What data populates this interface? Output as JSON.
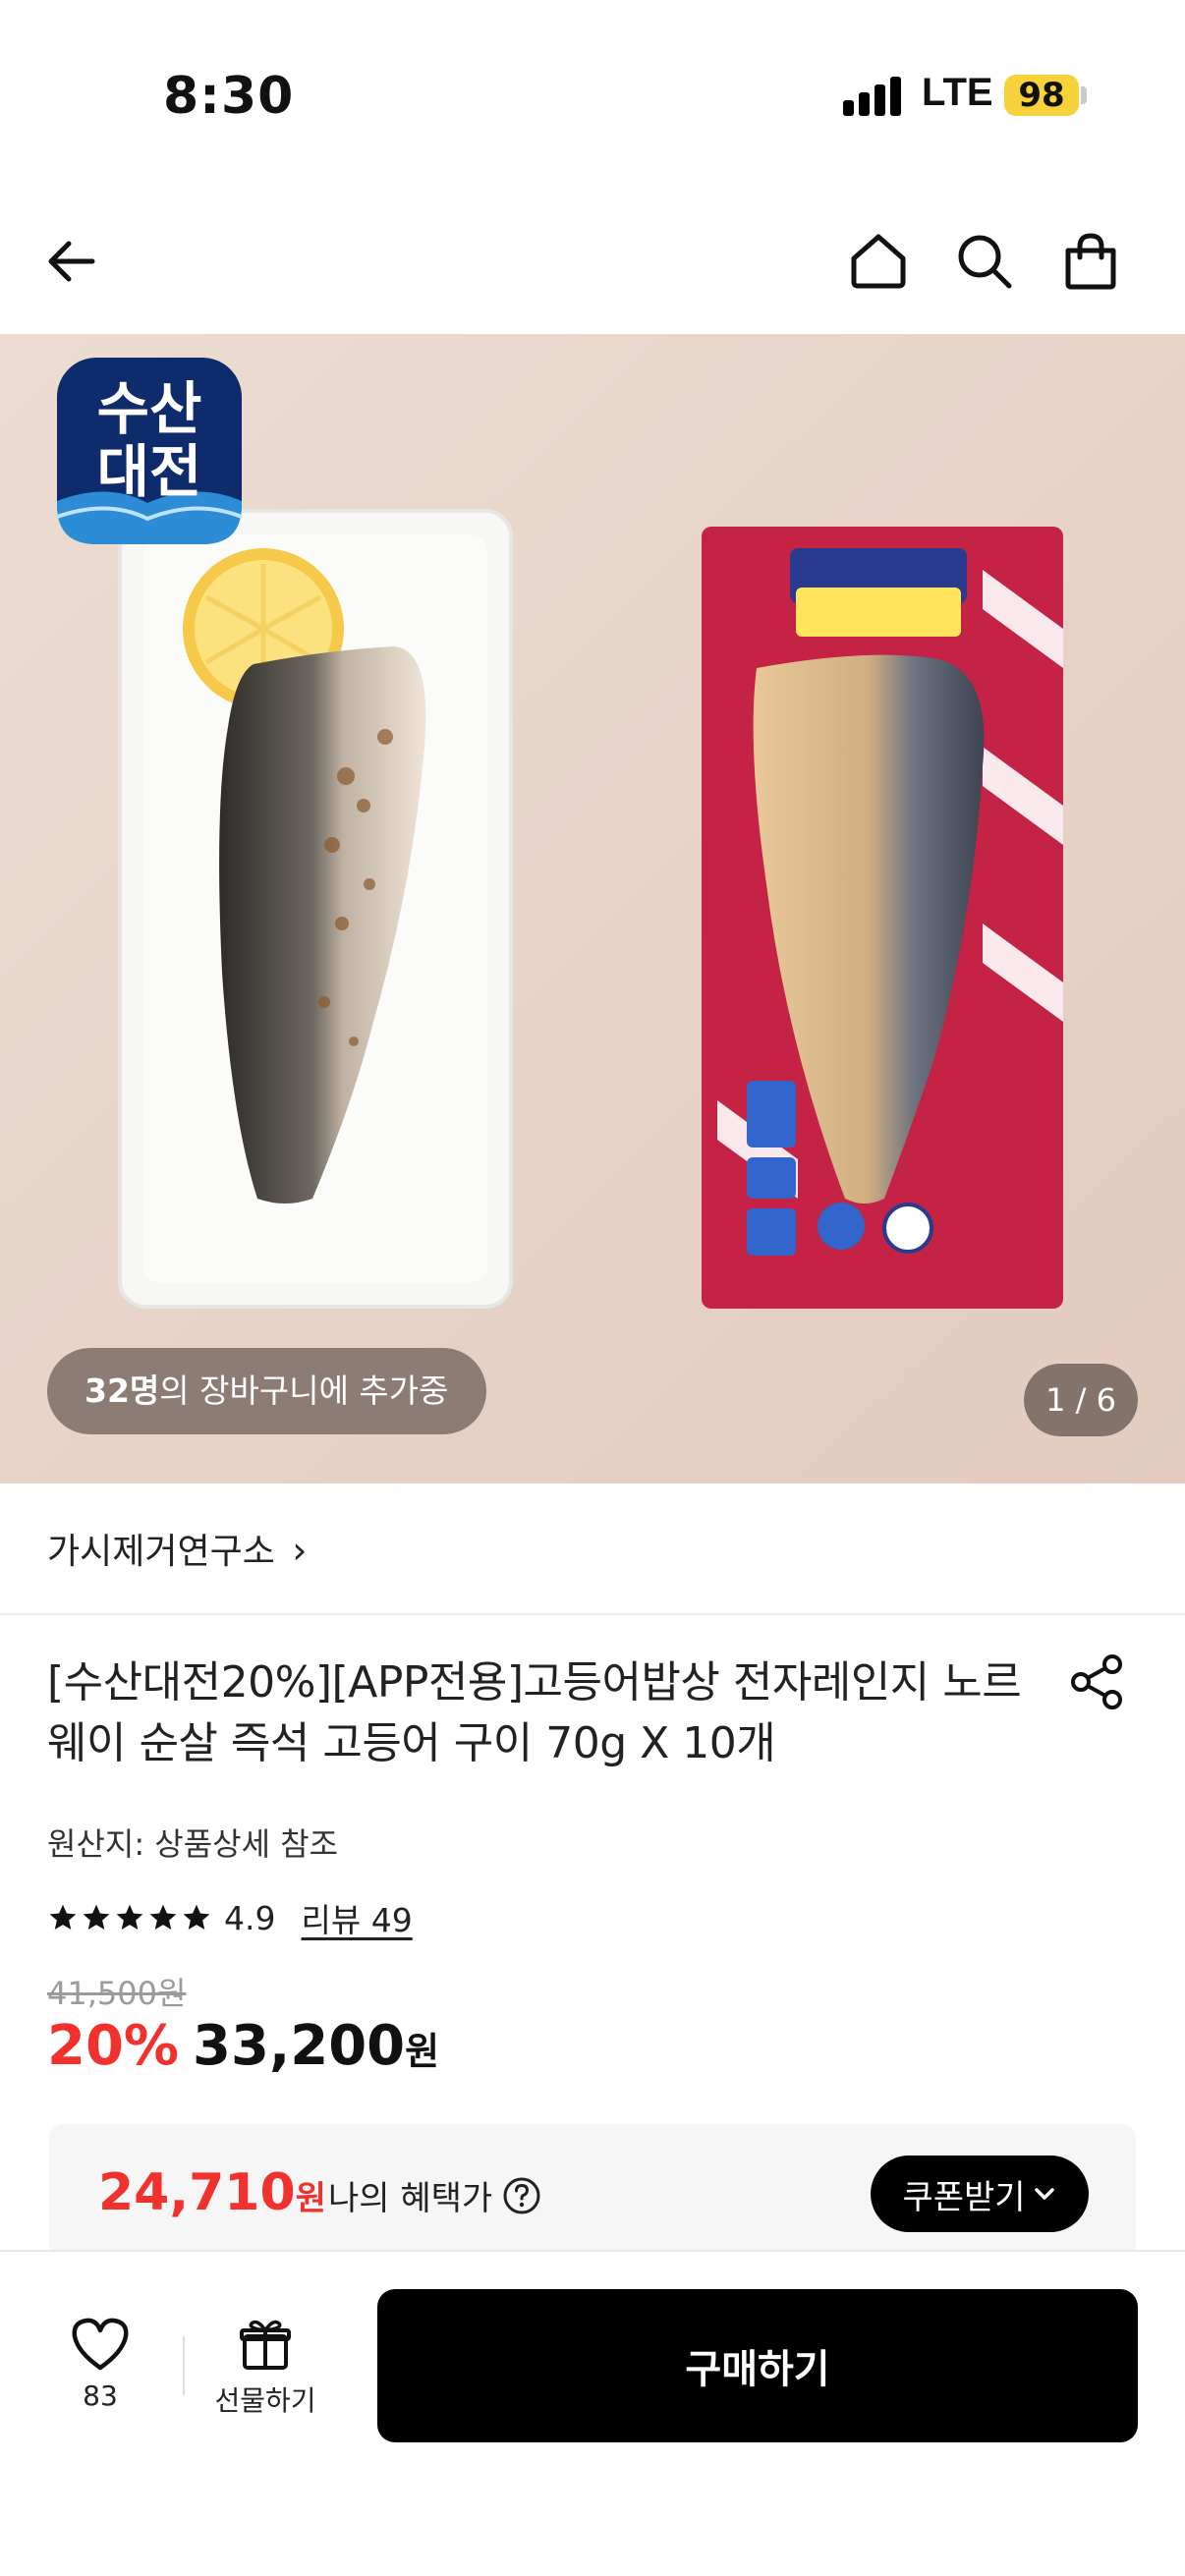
{
  "status_bar": {
    "time": "8:30",
    "network": "LTE",
    "battery": "98"
  },
  "hero": {
    "logo_text_line1": "수산",
    "logo_text_line2": "대전",
    "cart_count": "32명",
    "cart_text": "의 장바구니에 추가중",
    "page_indicator": "1 / 6"
  },
  "brand": {
    "name": "가시제거연구소",
    "chevron": "›"
  },
  "product": {
    "title": "[수산대전20%][APP전용]고등어밥상 전자레인지 노르웨이 순살 즉석 고등어 구이 70g X 10개",
    "origin": "원산지: 상품상세 참조",
    "rating": "4.9",
    "review_label": "리뷰 49",
    "original_price": "41,500원",
    "discount": "20%",
    "price": "33,200",
    "price_unit": "원"
  },
  "benefit": {
    "price": "24,710",
    "price_unit": "원",
    "label": "나의 혜택가",
    "coupon_button": "쿠폰받기"
  },
  "bottom_bar": {
    "like_count": "83",
    "gift_label": "선물하기",
    "buy_label": "구매하기"
  },
  "colors": {
    "accent_red": "#f0312d",
    "battery_yellow": "#f7d23b",
    "hero_background": "#e9d6cc"
  },
  "icons": {
    "back": "arrow-left-icon",
    "home": "home-icon",
    "search": "search-icon",
    "bag": "shopping-bag-icon",
    "share": "share-icon",
    "star": "star-icon",
    "help": "question-circle-icon",
    "heart": "heart-icon",
    "gift": "gift-icon"
  }
}
